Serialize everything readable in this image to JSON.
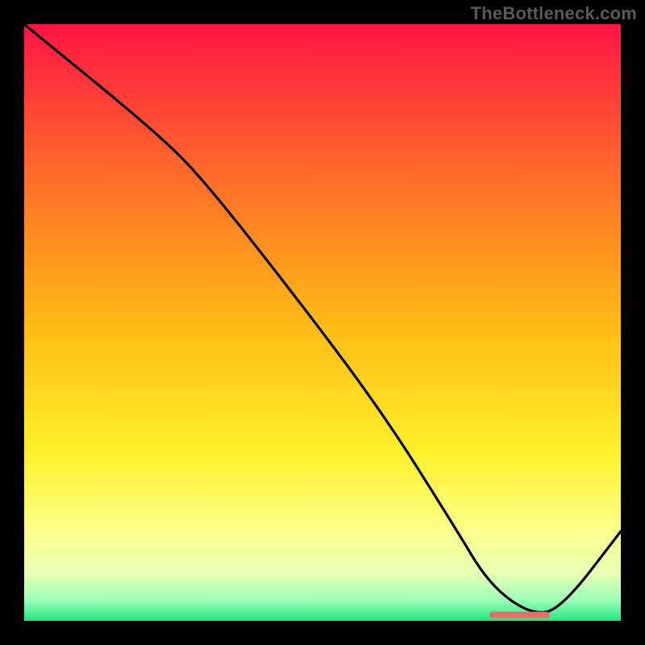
{
  "watermark": "TheBottleneck.com",
  "chart_data": {
    "type": "line",
    "title": "",
    "xlabel": "",
    "ylabel": "",
    "xlim": [
      0,
      100
    ],
    "ylim": [
      0,
      100
    ],
    "grid": false,
    "background_gradient_stops": [
      {
        "pos": 0.0,
        "color": "#ff1444"
      },
      {
        "pos": 0.25,
        "color": "#ff6a2a"
      },
      {
        "pos": 0.5,
        "color": "#ffb915"
      },
      {
        "pos": 0.72,
        "color": "#fff12a"
      },
      {
        "pos": 0.85,
        "color": "#fcff8c"
      },
      {
        "pos": 0.92,
        "color": "#e8ffb4"
      },
      {
        "pos": 0.965,
        "color": "#9dffb8"
      },
      {
        "pos": 1.0,
        "color": "#1fe87e"
      }
    ],
    "series": [
      {
        "name": "bottleneck-curve",
        "x": [
          0,
          22,
          30,
          45,
          60,
          72,
          78,
          85,
          90,
          100
        ],
        "y": [
          100,
          82,
          74,
          55,
          35,
          16,
          6,
          1,
          2,
          15
        ]
      }
    ],
    "marker": {
      "name": "optimum-range",
      "x_start": 78,
      "x_end": 88,
      "y": 1,
      "color": "#e36f6a"
    }
  }
}
